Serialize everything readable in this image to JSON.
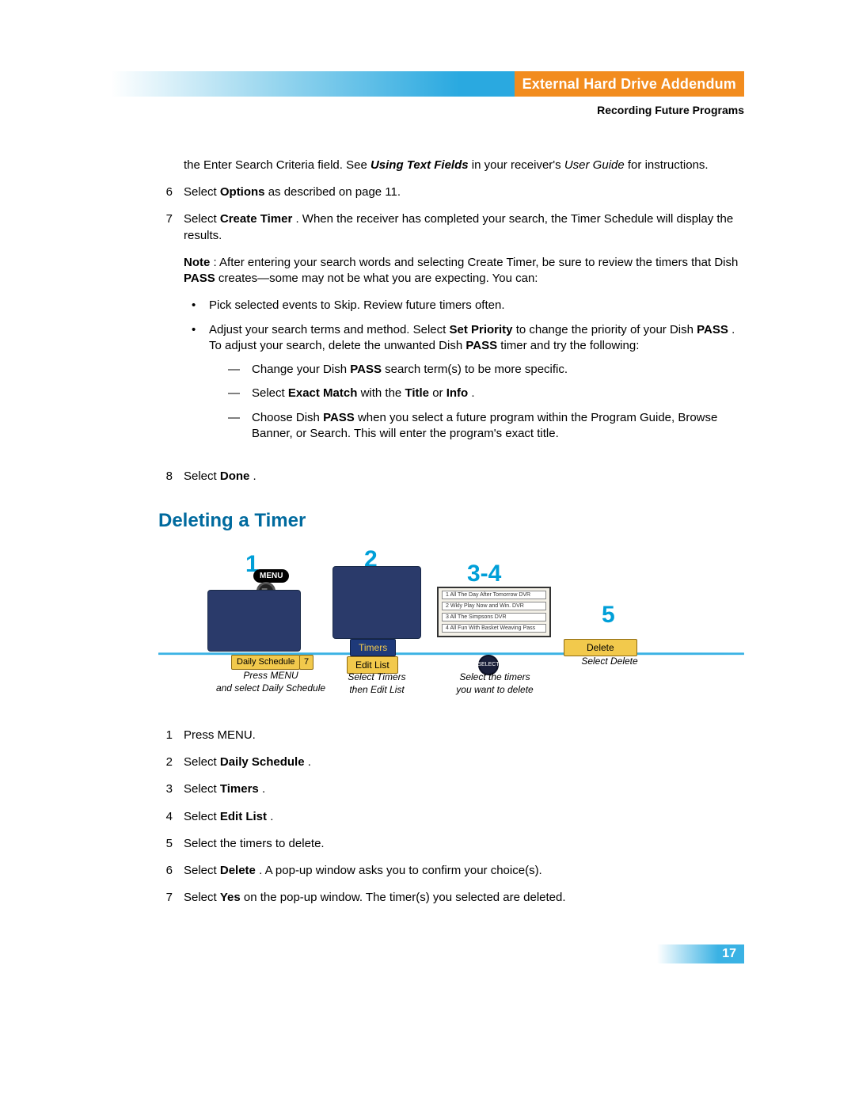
{
  "header": {
    "banner_title": "External Hard Drive Addendum",
    "subhead": "Recording Future Programs"
  },
  "intro_fragment": {
    "pre": "the Enter Search Criteria field. See ",
    "bi": "Using Text Fields",
    "mid": " in your receiver's ",
    "it": "User Guide",
    "post": " for instructions."
  },
  "step6": {
    "num": "6",
    "pre": "Select ",
    "b1": "Options",
    "post": " as described on page 11."
  },
  "step7": {
    "num": "7",
    "pre": "Select ",
    "b1": "Create Timer",
    "post": ". When the receiver has completed your search, the Timer Schedule will display the results."
  },
  "note": {
    "nb": "Note",
    "pre": ": After entering your search words and selecting Create Timer, be sure to review the timers that Dish",
    "b1": "PASS",
    "post": " creates—some may not be what you are expecting. You can:"
  },
  "bullets": {
    "b1": "Pick selected events to Skip. Review future timers often.",
    "b2": {
      "pre": "Adjust your search terms and method. Select ",
      "bd1": "Set Priority",
      "mid1": " to change the priority of your Dish",
      "bd2": "PASS",
      "mid2": ". To adjust your search, delete the unwanted Dish",
      "bd3": "PASS",
      "post": " timer and try the following:"
    },
    "d1": {
      "pre": "Change your Dish",
      "bd": "PASS",
      "post": " search term(s) to be more specific."
    },
    "d2": {
      "pre": "Select ",
      "bd1": "Exact Match",
      "mid": " with the ",
      "bd2": "Title",
      "or": " or ",
      "bd3": "Info",
      "end": "."
    },
    "d3": {
      "pre": "Choose Dish",
      "bd": "PASS",
      "post": " when you select a future program within the Program Guide, Browse Banner, or Search. This will enter the program's exact title."
    }
  },
  "step8": {
    "num": "8",
    "pre": "Select ",
    "b1": "Done",
    "post": "."
  },
  "section_title": "Deleting a Timer",
  "diagram": {
    "n1": "1",
    "n2": "2",
    "n34": "3-4",
    "n5": "5",
    "menu_label": "MENU",
    "daily_schedule_chip": "Daily Schedule",
    "daily_schedule_num": "7",
    "timers_chip": "Timers",
    "edit_list_chip": "Edit List",
    "delete_chip": "Delete",
    "select_puck": "SELECT",
    "cap1_l1": "Press MENU",
    "cap1_l2": "and select Daily Schedule",
    "cap2_l1": "Select Timers",
    "cap2_l2": "then Edit List",
    "cap3_l1": "Select the timers",
    "cap3_l2": "you want to delete",
    "cap4": "Select Delete",
    "timer_rows": [
      "1  All   The Day After Tomorrow   DVR",
      "2  Wkly  Play Now and Win.        DVR",
      "3  All   The Simpsons             DVR",
      "4  All   Fun With Basket Weaving  Pass"
    ]
  },
  "del_steps": {
    "s1": {
      "num": "1",
      "text": "Press MENU."
    },
    "s2": {
      "num": "2",
      "pre": "Select ",
      "b": "Daily Schedule",
      "post": "."
    },
    "s3": {
      "num": "3",
      "pre": "Select ",
      "b": "Timers",
      "post": "."
    },
    "s4": {
      "num": "4",
      "pre": "Select ",
      "b": "Edit List",
      "post": "."
    },
    "s5": {
      "num": "5",
      "text": "Select the timers to delete."
    },
    "s6": {
      "num": "6",
      "pre": "Select ",
      "b": "Delete",
      "post": ". A pop-up window asks you to confirm your choice(s)."
    },
    "s7": {
      "num": "7",
      "pre": "Select ",
      "b": "Yes",
      "post": " on the pop-up window. The timer(s) you selected are deleted."
    }
  },
  "page_number": "17"
}
